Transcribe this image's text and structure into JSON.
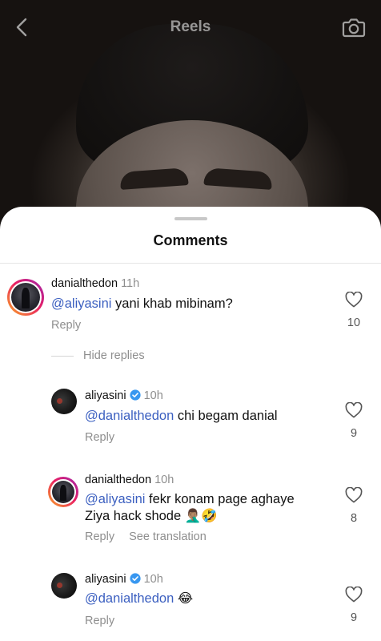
{
  "header": {
    "title": "Reels",
    "back_icon": "chevron-left-icon",
    "camera_icon": "camera-icon"
  },
  "sheet": {
    "title": "Comments"
  },
  "comments": [
    {
      "username": "danialthedon",
      "time": "11h",
      "verified": false,
      "mention": "@aliyasini",
      "text": " yani khab mibinam?",
      "reply_label": "Reply",
      "likes": "10"
    }
  ],
  "hide_replies_label": "Hide replies",
  "replies": [
    {
      "username": "aliyasini",
      "time": "10h",
      "verified": true,
      "mention": "@danialthedon",
      "text": " chi begam danial",
      "reply_label": "Reply",
      "likes": "9"
    },
    {
      "username": "danialthedon",
      "time": "10h",
      "verified": false,
      "mention": "@aliyasini",
      "text_line1": " fekr konam page aghaye",
      "text_line2": "Ziya hack shode 🤦🏽‍♂️🤣",
      "reply_label": "Reply",
      "see_translation_label": "See translation",
      "likes": "8"
    },
    {
      "username": "aliyasini",
      "time": "10h",
      "verified": true,
      "mention": "@danialthedon",
      "text": " 😂",
      "reply_label": "Reply",
      "likes": "9"
    }
  ],
  "colors": {
    "mention": "#3b5fc0",
    "verified_badge": "#3897f0",
    "muted_text": "#8e8e8e"
  }
}
